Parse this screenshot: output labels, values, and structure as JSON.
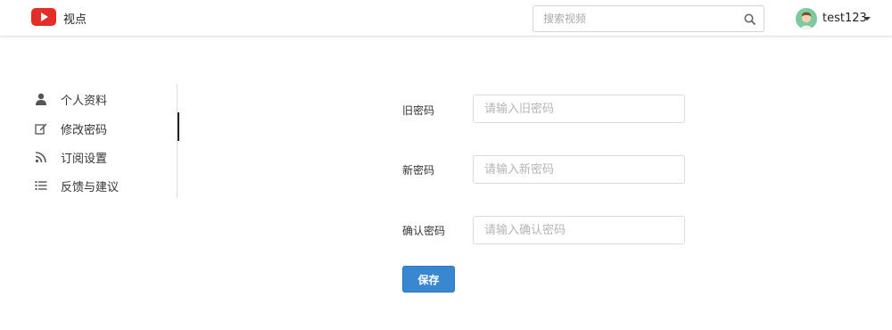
{
  "header": {
    "brand": "视点",
    "logo_icon": "play-logo-icon",
    "search_placeholder": "搜索视频",
    "search_icon": "search-icon",
    "username": "test123",
    "avatar_icon": "user-avatar",
    "dropdown_icon": "caret-down-icon"
  },
  "sidebar": {
    "items": [
      {
        "label": "个人资料",
        "icon": "user-icon"
      },
      {
        "label": "修改密码",
        "icon": "edit-icon"
      },
      {
        "label": "订阅设置",
        "icon": "rss-icon"
      },
      {
        "label": "反馈与建议",
        "icon": "list-icon"
      }
    ],
    "active_index": 1
  },
  "form": {
    "old_password": {
      "label": "旧密码",
      "placeholder": "请输入旧密码",
      "value": ""
    },
    "new_password": {
      "label": "新密码",
      "placeholder": "请输入新密码",
      "value": ""
    },
    "confirm_password": {
      "label": "确认密码",
      "placeholder": "请输入确认密码",
      "value": ""
    },
    "save_label": "保存"
  },
  "colors": {
    "logo_red": "#e52d27",
    "primary_button": "#3a87d1",
    "avatar_bg": "#7ec9a0"
  }
}
